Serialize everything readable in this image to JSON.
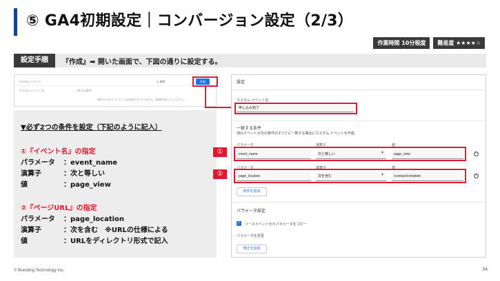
{
  "title": "⑤ GA4初期設定｜コンバージョン設定（2/3）",
  "badges": [
    "作業時間 10分程度",
    "難易度 ★★★★☆"
  ],
  "step": {
    "label": "設定手順",
    "text": "『作成』➡ 開いた画面で、下図の通りに設定する。"
  },
  "mini": {
    "search": "カスタム イベント",
    "col1": "カスタム イベント名",
    "col2": "一致する条件",
    "empty": "現在カスタム イベントは作成されていません。新規作成してください。",
    "q": "Q 検索",
    "create_button": "作成"
  },
  "conditions": {
    "heading": "▼必ず2つの条件を設定（下記のように記入）",
    "c1_title": "①『イベント名』の指定",
    "c1_rows": [
      {
        "key": "パラメータ",
        "value": "：event_name"
      },
      {
        "key": "演算子",
        "value": "：次と等しい"
      },
      {
        "key": "値",
        "value": "：page_view"
      }
    ],
    "c2_title": "②『ページURL』の指定",
    "c2_rows": [
      {
        "key": "パラメータ",
        "value": "：page_location"
      },
      {
        "key": "演算子",
        "value": "：次を含む　※URLの仕様による"
      },
      {
        "key": "値",
        "value": "：URLをディレクトリ形式で記入"
      }
    ]
  },
  "panel": {
    "header": "設定",
    "event_name_label": "カスタム イベント名",
    "event_name_value": "申し込み完了",
    "match_title": "一致する条件",
    "match_desc": "他のイベントが次の条件のすべてに一致する場合にカスタム イベントを作成",
    "col_param": "パラメータ",
    "col_op": "演算子",
    "col_val": "値",
    "row1": {
      "param": "event_name",
      "op": "次と等しい",
      "val": "page_view"
    },
    "row2": {
      "param": "page_location",
      "op": "次を含む",
      "val": "/contact/complete"
    },
    "add_condition": "条件を追加",
    "param_settings": "パラメータ設定",
    "copy_params": "ソースイベントからパラメータをコピー",
    "modify_params": "パラメータを変更",
    "add_modification": "修正を追加"
  },
  "num_labels": [
    "①",
    "②"
  ],
  "footer": "© Branding Technology Inc.",
  "page": "34",
  "colors": {
    "accent": "#1a3f93",
    "highlight": "#e0172d",
    "link": "#1a73e8"
  }
}
